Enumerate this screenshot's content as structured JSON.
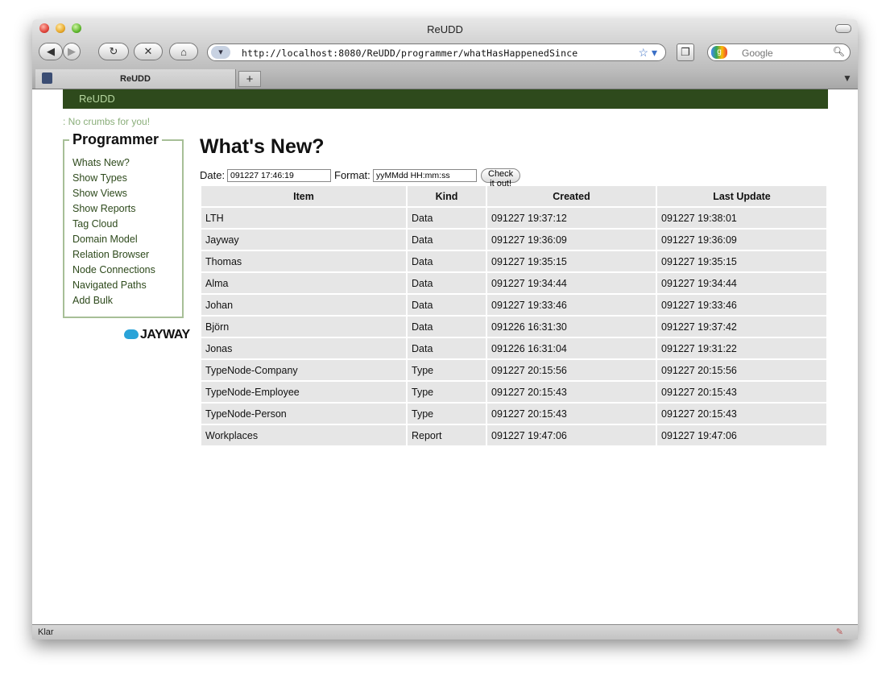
{
  "window": {
    "title": "ReUDD"
  },
  "toolbar": {
    "back_glyph": "◀",
    "forward_glyph": "▶",
    "reload_glyph": "↻",
    "stop_glyph": "✕",
    "home_glyph": "⌂",
    "url": "http://localhost:8080/ReUDD/programmer/whatHasHappenedSince",
    "search_placeholder": "Google"
  },
  "tabs": [
    {
      "label": "ReUDD"
    }
  ],
  "newtab_glyph": "+",
  "site": {
    "nav_link": "ReUDD",
    "crumbs": ": No crumbs for you!",
    "sidebar": {
      "title": "Programmer",
      "items": [
        "Whats New?",
        "Show Types",
        "Show Views",
        "Show Reports",
        "Tag Cloud",
        "Domain Model",
        "Relation Browser",
        "Node Connections",
        "Navigated Paths",
        "Add Bulk"
      ]
    },
    "logo_text": "JAYWAY"
  },
  "main": {
    "heading": "What's New?",
    "date_label": "Date:",
    "date_value": "091227 17:46:19",
    "format_label": "Format:",
    "format_value": "yyMMdd HH:mm:ss",
    "submit_label": "Check it out!",
    "columns": [
      "Item",
      "Kind",
      "Created",
      "Last Update"
    ],
    "rows": [
      [
        "LTH",
        "Data",
        "091227 19:37:12",
        "091227 19:38:01"
      ],
      [
        "Jayway",
        "Data",
        "091227 19:36:09",
        "091227 19:36:09"
      ],
      [
        "Thomas",
        "Data",
        "091227 19:35:15",
        "091227 19:35:15"
      ],
      [
        "Alma",
        "Data",
        "091227 19:34:44",
        "091227 19:34:44"
      ],
      [
        "Johan",
        "Data",
        "091227 19:33:46",
        "091227 19:33:46"
      ],
      [
        "Björn",
        "Data",
        "091226 16:31:30",
        "091227 19:37:42"
      ],
      [
        "Jonas",
        "Data",
        "091226 16:31:04",
        "091227 19:31:22"
      ],
      [
        "TypeNode-Company",
        "Type",
        "091227 20:15:56",
        "091227 20:15:56"
      ],
      [
        "TypeNode-Employee",
        "Type",
        "091227 20:15:43",
        "091227 20:15:43"
      ],
      [
        "TypeNode-Person",
        "Type",
        "091227 20:15:43",
        "091227 20:15:43"
      ],
      [
        "Workplaces",
        "Report",
        "091227 19:47:06",
        "091227 19:47:06"
      ]
    ]
  },
  "status": {
    "text": "Klar"
  },
  "colors": {
    "nav_bg": "#2e4a1c",
    "nav_link": "#b6d6a0",
    "sidebar_border": "#a7bf97",
    "link": "#2e4a1c",
    "cell_bg": "#e6e6e6"
  }
}
